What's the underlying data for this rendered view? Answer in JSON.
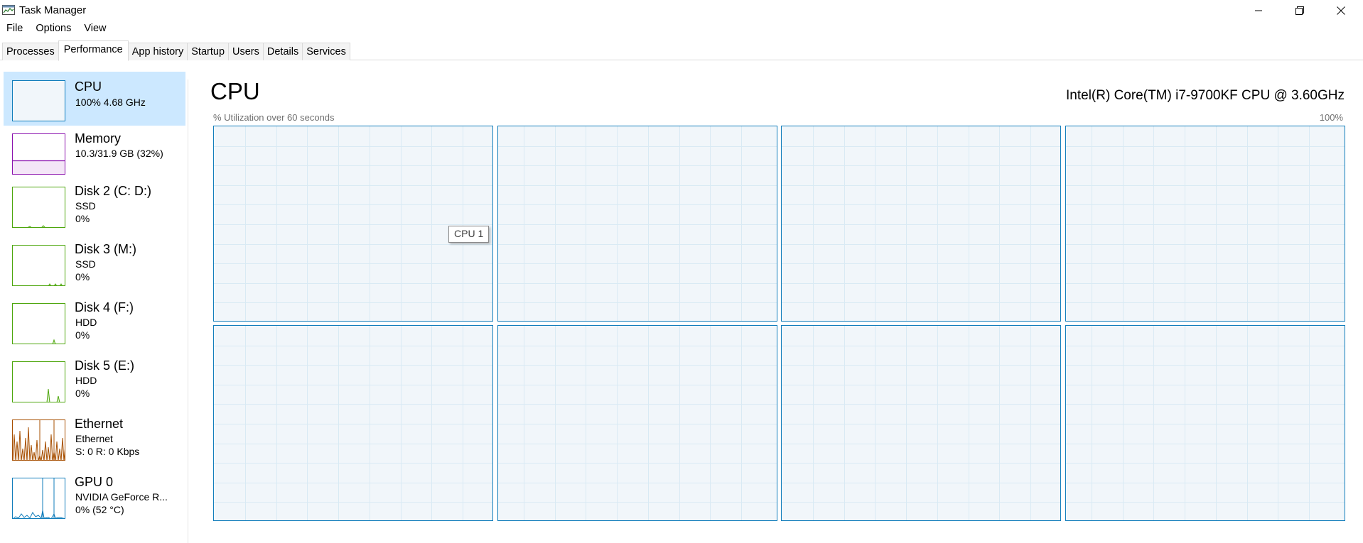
{
  "window": {
    "title": "Task Manager",
    "app_icon": "task-manager-icon",
    "controls": [
      "minimize-icon",
      "restore-icon",
      "close-icon"
    ]
  },
  "menu": {
    "items": [
      "File",
      "Options",
      "View"
    ]
  },
  "tabs": {
    "items": [
      "Processes",
      "Performance",
      "App history",
      "Startup",
      "Users",
      "Details",
      "Services"
    ],
    "active": "Performance"
  },
  "sidebar": {
    "items": [
      {
        "name": "CPU",
        "line1": "100%  4.68 GHz",
        "line2": "",
        "color": "#117dbb",
        "selected": true
      },
      {
        "name": "Memory",
        "line1": "10.3/31.9 GB (32%)",
        "line2": "",
        "color": "#8b12ae",
        "selected": false
      },
      {
        "name": "Disk 2 (C: D:)",
        "line1": "SSD",
        "line2": "0%",
        "color": "#4da60c",
        "selected": false
      },
      {
        "name": "Disk 3 (M:)",
        "line1": "SSD",
        "line2": "0%",
        "color": "#4da60c",
        "selected": false
      },
      {
        "name": "Disk 4 (F:)",
        "line1": "HDD",
        "line2": "0%",
        "color": "#4da60c",
        "selected": false
      },
      {
        "name": "Disk 5 (E:)",
        "line1": "HDD",
        "line2": "0%",
        "color": "#4da60c",
        "selected": false
      },
      {
        "name": "Ethernet",
        "line1": "Ethernet",
        "line2": "S: 0  R: 0 Kbps",
        "color": "#a74f01",
        "selected": false
      },
      {
        "name": "GPU 0",
        "line1": "NVIDIA GeForce R...",
        "line2": "0%  (52 °C)",
        "color": "#117dbb",
        "selected": false
      }
    ]
  },
  "main": {
    "title": "CPU",
    "processor": "Intel(R) Core(TM) i7-9700KF CPU @ 3.60GHz",
    "util_label": "% Utilization over 60 seconds",
    "util_max": "100%",
    "tooltip": "CPU 1",
    "core_count": 8,
    "graph_color": "#117dbb",
    "grid_color": "#d9eaf4"
  }
}
